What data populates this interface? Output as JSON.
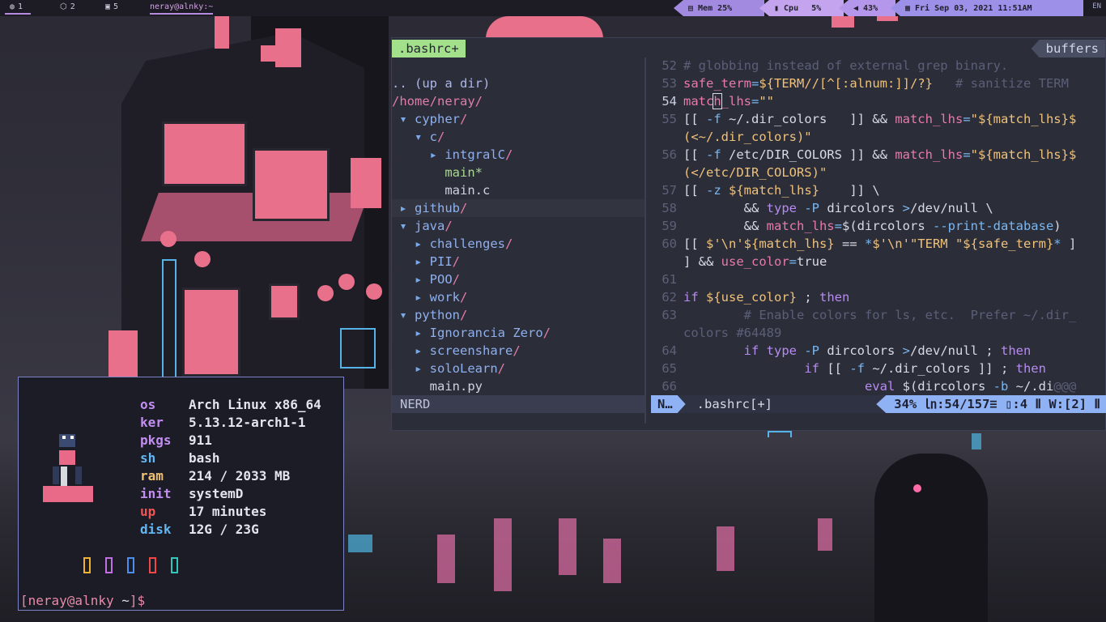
{
  "topbar": {
    "workspaces": [
      {
        "icon": "globe-icon",
        "label": "1"
      },
      {
        "icon": "code-icon",
        "label": "2"
      },
      {
        "icon": "image-icon",
        "label": "5"
      }
    ],
    "window_title": "neray@alnky:~",
    "mem": {
      "label": "Mem",
      "value": "25%"
    },
    "cpu": {
      "label": "Cpu",
      "value": "5%"
    },
    "volume": {
      "value": "43%"
    },
    "datetime": "Fri Sep 03, 2021 11:51AM",
    "lang": "EN"
  },
  "editor": {
    "active_tab": ".bashrc+",
    "buffers_label": "buffers",
    "tree": [
      {
        "kind": "up",
        "text": ".. (up a dir)"
      },
      {
        "kind": "path",
        "text": "/home/neray/"
      },
      {
        "kind": "dir-open",
        "indent": 0,
        "name": "cypher"
      },
      {
        "kind": "dir-open",
        "indent": 1,
        "name": "c"
      },
      {
        "kind": "dir",
        "indent": 2,
        "name": "intgralC"
      },
      {
        "kind": "exe",
        "indent": 2,
        "name": "main*"
      },
      {
        "kind": "file",
        "indent": 2,
        "name": "main.c"
      },
      {
        "kind": "dir",
        "indent": 0,
        "name": "github",
        "highlight": true
      },
      {
        "kind": "dir-open",
        "indent": 0,
        "name": "java"
      },
      {
        "kind": "dir",
        "indent": 1,
        "name": "challenges"
      },
      {
        "kind": "dir",
        "indent": 1,
        "name": "PII"
      },
      {
        "kind": "dir",
        "indent": 1,
        "name": "POO"
      },
      {
        "kind": "dir",
        "indent": 1,
        "name": "work"
      },
      {
        "kind": "dir-open",
        "indent": 0,
        "name": "python"
      },
      {
        "kind": "dir",
        "indent": 1,
        "name": "Ignorancia Zero"
      },
      {
        "kind": "dir",
        "indent": 1,
        "name": "screenshare"
      },
      {
        "kind": "dir",
        "indent": 1,
        "name": "soloLearn"
      },
      {
        "kind": "file",
        "indent": 1,
        "name": "main.py"
      }
    ],
    "code_lines": [
      {
        "n": "52",
        "segs": [
          [
            "com",
            "# globbing instead of external grep binary."
          ]
        ]
      },
      {
        "n": "53",
        "segs": [
          [
            "var",
            "safe_term"
          ],
          [
            "op",
            "="
          ],
          [
            "str",
            "${TERM//[^[:alnum:]]/?}"
          ],
          [
            "pl",
            "   "
          ],
          [
            "com",
            "# sanitize TERM"
          ]
        ]
      },
      {
        "n": "54",
        "cur": true,
        "segs": [
          [
            "var",
            "matc"
          ],
          [
            "cursor",
            "h"
          ],
          [
            "var",
            "_lhs"
          ],
          [
            "op",
            "="
          ],
          [
            "str",
            "\"\""
          ]
        ]
      },
      {
        "n": "55",
        "segs": [
          [
            "pl",
            "[[ "
          ],
          [
            "op",
            "-f"
          ],
          [
            "pl",
            " ~/.dir_colors   ]] && "
          ],
          [
            "var",
            "match_lhs"
          ],
          [
            "op",
            "="
          ],
          [
            "str",
            "\"${match_lhs}$"
          ]
        ]
      },
      {
        "n": "",
        "segs": [
          [
            "str",
            "(<~/.dir_colors)\""
          ]
        ]
      },
      {
        "n": "56",
        "segs": [
          [
            "pl",
            "[[ "
          ],
          [
            "op",
            "-f"
          ],
          [
            "pl",
            " /etc/DIR_COLORS ]] && "
          ],
          [
            "var",
            "match_lhs"
          ],
          [
            "op",
            "="
          ],
          [
            "str",
            "\"${match_lhs}$"
          ]
        ]
      },
      {
        "n": "",
        "segs": [
          [
            "str",
            "(</etc/DIR_COLORS)\""
          ]
        ]
      },
      {
        "n": "57",
        "segs": [
          [
            "pl",
            "[[ "
          ],
          [
            "op",
            "-z"
          ],
          [
            "pl",
            " "
          ],
          [
            "str",
            "${match_lhs}"
          ],
          [
            "pl",
            "    ]] \\"
          ]
        ]
      },
      {
        "n": "58",
        "segs": [
          [
            "pl",
            "        && "
          ],
          [
            "kw",
            "type"
          ],
          [
            "pl",
            " "
          ],
          [
            "op",
            "-P"
          ],
          [
            "pl",
            " dircolors "
          ],
          [
            "op",
            ">"
          ],
          [
            "pl",
            "/dev/null \\"
          ]
        ]
      },
      {
        "n": "59",
        "segs": [
          [
            "pl",
            "        && "
          ],
          [
            "var",
            "match_lhs"
          ],
          [
            "op",
            "="
          ],
          [
            "pl",
            "$(dircolors "
          ],
          [
            "op",
            "--print-database"
          ],
          [
            "pl",
            ")"
          ]
        ]
      },
      {
        "n": "60",
        "segs": [
          [
            "pl",
            "[[ "
          ],
          [
            "str",
            "$'\\n'${match_lhs}"
          ],
          [
            "pl",
            " == "
          ],
          [
            "op",
            "*"
          ],
          [
            "str",
            "$'\\n'\"TERM \"${safe_term}"
          ],
          [
            "op",
            "*"
          ],
          [
            "pl",
            " ]"
          ]
        ]
      },
      {
        "n": "",
        "segs": [
          [
            "pl",
            "] && "
          ],
          [
            "var",
            "use_color"
          ],
          [
            "op",
            "="
          ],
          [
            "pl",
            "true"
          ]
        ]
      },
      {
        "n": "61",
        "segs": [
          [
            "pl",
            ""
          ]
        ]
      },
      {
        "n": "62",
        "segs": [
          [
            "kw",
            "if"
          ],
          [
            "pl",
            " "
          ],
          [
            "str",
            "${use_color}"
          ],
          [
            "pl",
            " ; "
          ],
          [
            "kw",
            "then"
          ]
        ]
      },
      {
        "n": "63",
        "segs": [
          [
            "com",
            "        # Enable colors for ls, etc.  Prefer ~/.dir_"
          ]
        ]
      },
      {
        "n": "",
        "segs": [
          [
            "com",
            "colors #64489"
          ]
        ]
      },
      {
        "n": "64",
        "segs": [
          [
            "pl",
            "        "
          ],
          [
            "kw",
            "if"
          ],
          [
            "pl",
            " "
          ],
          [
            "kw",
            "type"
          ],
          [
            "pl",
            " "
          ],
          [
            "op",
            "-P"
          ],
          [
            "pl",
            " dircolors "
          ],
          [
            "op",
            ">"
          ],
          [
            "pl",
            "/dev/null ; "
          ],
          [
            "kw",
            "then"
          ]
        ]
      },
      {
        "n": "65",
        "segs": [
          [
            "pl",
            "                "
          ],
          [
            "kw",
            "if"
          ],
          [
            "pl",
            " [[ "
          ],
          [
            "op",
            "-f"
          ],
          [
            "pl",
            " ~/.dir_colors ]] ; "
          ],
          [
            "kw",
            "then"
          ]
        ]
      },
      {
        "n": "66",
        "segs": [
          [
            "pl",
            "                        "
          ],
          [
            "kw",
            "eval"
          ],
          [
            "pl",
            " $(dircolors "
          ],
          [
            "op",
            "-b"
          ],
          [
            "pl",
            " ~/.di"
          ],
          [
            "com",
            "@@@"
          ]
        ]
      }
    ],
    "status_left": "NERD",
    "status_mode": "N…",
    "status_file": ".bashrc[+]",
    "status_pos": "34% ㏑:54/157≡ ▯:4 Ⅱ W:[2] Ⅱ"
  },
  "fetch": {
    "rows": [
      {
        "key": "os",
        "value": "Arch Linux x86_64",
        "cls": "k-os"
      },
      {
        "key": "ker",
        "value": "5.13.12-arch1-1",
        "cls": "k-ker"
      },
      {
        "key": "pkgs",
        "value": "911",
        "cls": "k-pkgs"
      },
      {
        "key": "sh",
        "value": "bash",
        "cls": "k-sh"
      },
      {
        "key": "ram",
        "value": "214 / 2033 MB",
        "cls": "k-ram"
      },
      {
        "key": "init",
        "value": "systemD",
        "cls": "k-init"
      },
      {
        "key": "up",
        "value": "17 minutes",
        "cls": "k-up"
      },
      {
        "key": "disk",
        "value": "12G / 23G",
        "cls": "k-disk"
      }
    ],
    "palette": [
      "#f0b030",
      "#c070e0",
      "#4a8ef0",
      "#f04848",
      "#30c8b8"
    ],
    "prompt": {
      "user": "[neray@alnky",
      "path": " ~",
      "end": "]$"
    }
  }
}
